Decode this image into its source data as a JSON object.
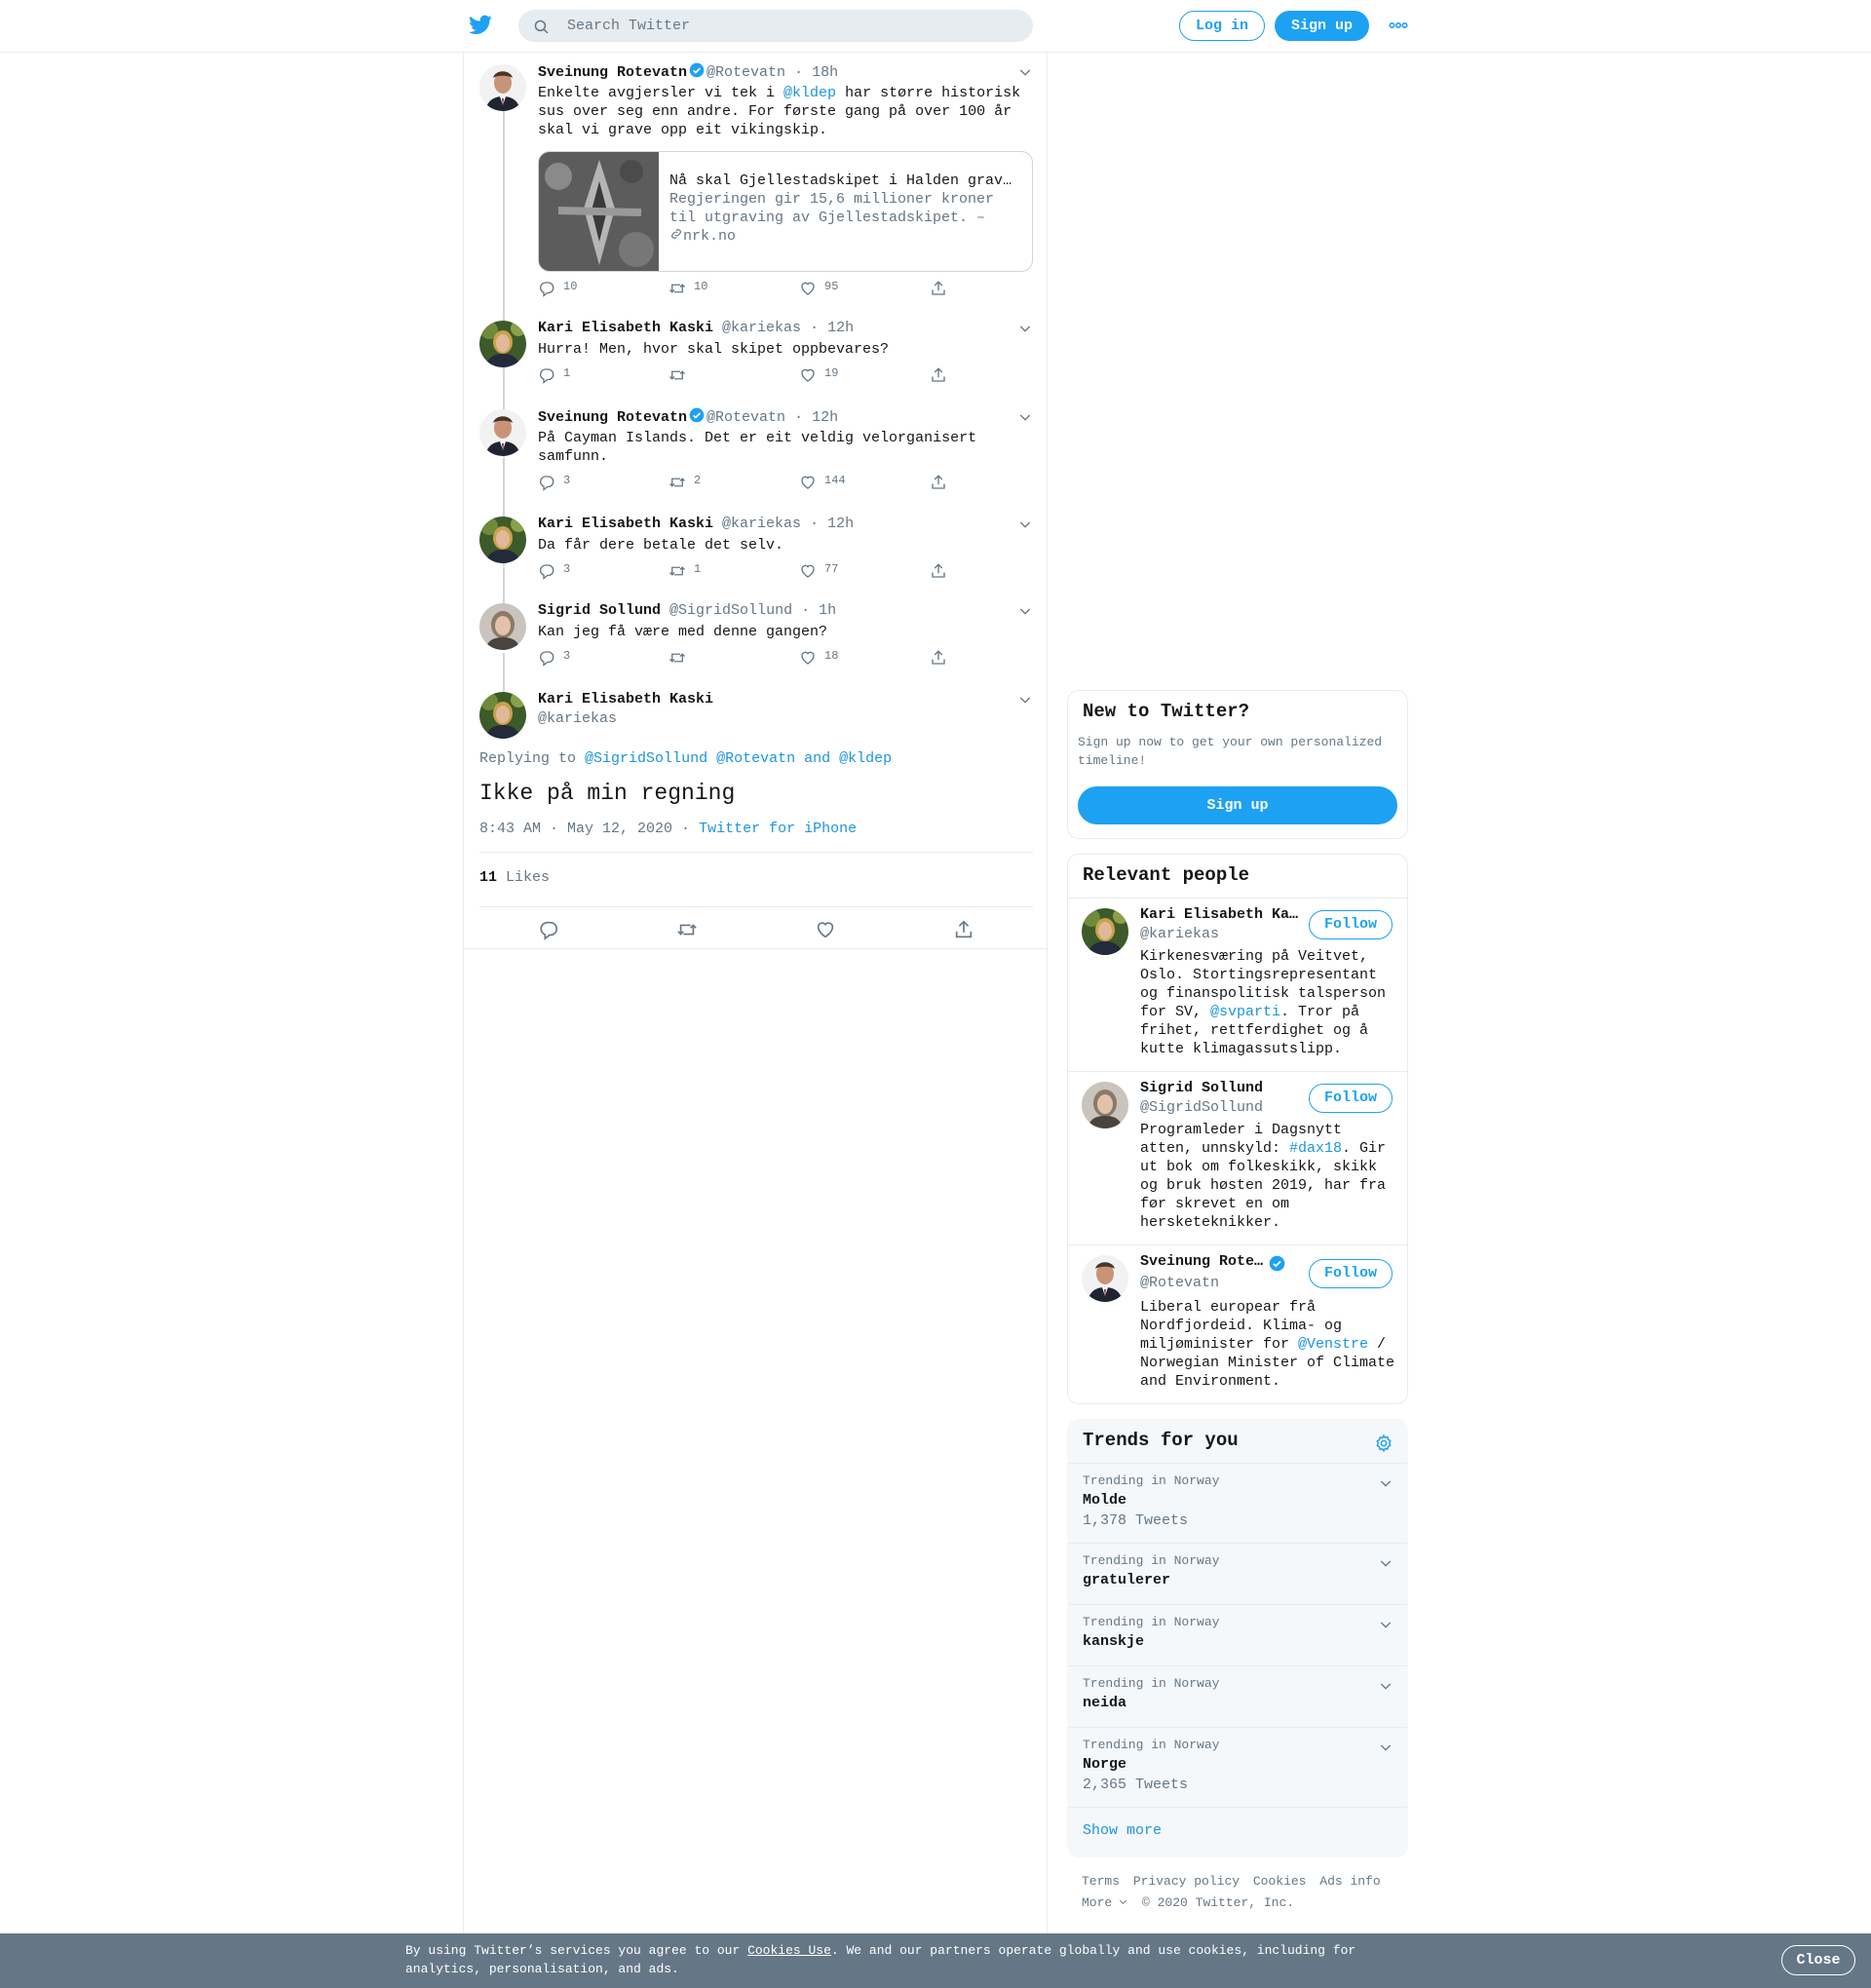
{
  "header": {
    "search_placeholder": "Search Twitter",
    "login_label": "Log in",
    "signup_label": "Sign up"
  },
  "thread": [
    {
      "name": "Sveinung Rotevatn",
      "verified": true,
      "handle": "@Rotevatn",
      "time": "· 18h",
      "text_before": "Enkelte avgjersler vi tek i ",
      "mention": "@kldep",
      "text_after": " har større historisk sus over seg enn andre. For første gang på over 100 år skal vi grave opp eit vikingskip.",
      "card": {
        "title": "Nå skal Gjellestadskipet i Halden graves ut",
        "description": "Regjeringen gir 15,6 millioner kroner til utgraving av Gjellestadskipet. – Det er en stor begivenhet",
        "domain": "nrk.no"
      },
      "replies": "10",
      "retweets": "10",
      "likes": "95"
    },
    {
      "name": "Kari Elisabeth Kaski",
      "handle": "@kariekas",
      "time": "· 12h",
      "text": "Hurra! Men, hvor skal skipet oppbevares?",
      "replies": "1",
      "retweets": "",
      "likes": "19"
    },
    {
      "name": "Sveinung Rotevatn",
      "verified": true,
      "handle": "@Rotevatn",
      "time": "· 12h",
      "text": "På Cayman Islands. Det er eit veldig velorganisert samfunn.",
      "replies": "3",
      "retweets": "2",
      "likes": "144"
    },
    {
      "name": "Kari Elisabeth Kaski",
      "handle": "@kariekas",
      "time": "· 12h",
      "text": "Da får dere betale det selv.",
      "replies": "3",
      "retweets": "1",
      "likes": "77"
    },
    {
      "name": "Sigrid Sollund",
      "handle": "@SigridSollund",
      "time": "· 1h",
      "text": "Kan jeg få være med denne gangen?",
      "replies": "3",
      "retweets": "",
      "likes": "18"
    }
  ],
  "focused": {
    "name": "Kari Elisabeth Kaski",
    "handle": "@kariekas",
    "replying_to_label": "Replying to",
    "replying_to": "@SigridSollund @Rotevatn and @kldep",
    "text": "Ikke på min regning",
    "timestamp": "8:43 AM · May 12, 2020 ·",
    "source": "Twitter for iPhone",
    "likes_count": "11",
    "likes_label": "Likes"
  },
  "sidebar": {
    "new_title": "New to Twitter?",
    "new_text": "Sign up now to get your own personalized timeline!",
    "signup_label": "Sign up",
    "relevant_title": "Relevant people",
    "follow_label": "Follow",
    "people": [
      {
        "name": "Kari Elisabeth Kaski",
        "handle": "@kariekas",
        "bio_before": "Kirkenesværing på Veitvet, Oslo. Stortingsrepresentant og finanspolitisk talsperson for SV, ",
        "bio_link": "@svparti",
        "bio_after": ". Tror på frihet, rettferdighet og å kutte klimagassutslipp."
      },
      {
        "name": "Sigrid Sollund",
        "handle": "@SigridSollund",
        "bio_before": "Programleder i Dagsnytt atten, unnskyld: ",
        "bio_link": "#dax18",
        "bio_after": ". Gir ut bok om folkeskikk, skikk og bruk høsten 2019, har fra før skrevet en om hersketeknikker."
      },
      {
        "name": "Sveinung Rotevatn",
        "handle": "@Rotevatn",
        "bio_before": "Liberal europear frå Nordfjordeid. Klima- og miljøminister for ",
        "bio_link": "@Venstre",
        "bio_after": " / Norwegian Minister of Climate and Environment."
      }
    ],
    "trends_title": "Trends for you",
    "trends": [
      {
        "context": "Trending in Norway",
        "name": "Molde",
        "count": "1,378 Tweets"
      },
      {
        "context": "Trending in Norway",
        "name": "gratulerer",
        "count": ""
      },
      {
        "context": "Trending in Norway",
        "name": "kanskje",
        "count": ""
      },
      {
        "context": "Trending in Norway",
        "name": "neida",
        "count": ""
      },
      {
        "context": "Trending in Norway",
        "name": "Norge",
        "count": "2,365 Tweets"
      }
    ],
    "show_more": "Show more",
    "footer": [
      "Terms",
      "Privacy policy",
      "Cookies",
      "Ads info"
    ],
    "footer_more": "More",
    "copyright": "© 2020 Twitter, Inc."
  },
  "cookie": {
    "text_before": "By using Twitter’s services you agree to our ",
    "link": "Cookies Use",
    "text_after": ". We and our partners operate globally and use cookies, including for analytics, personalisation, and ads.",
    "close_label": "Close"
  },
  "colors": {
    "accent": "#1da1f2",
    "link": "#1b95e0",
    "muted": "#657786",
    "cookie_bg": "#657786"
  }
}
